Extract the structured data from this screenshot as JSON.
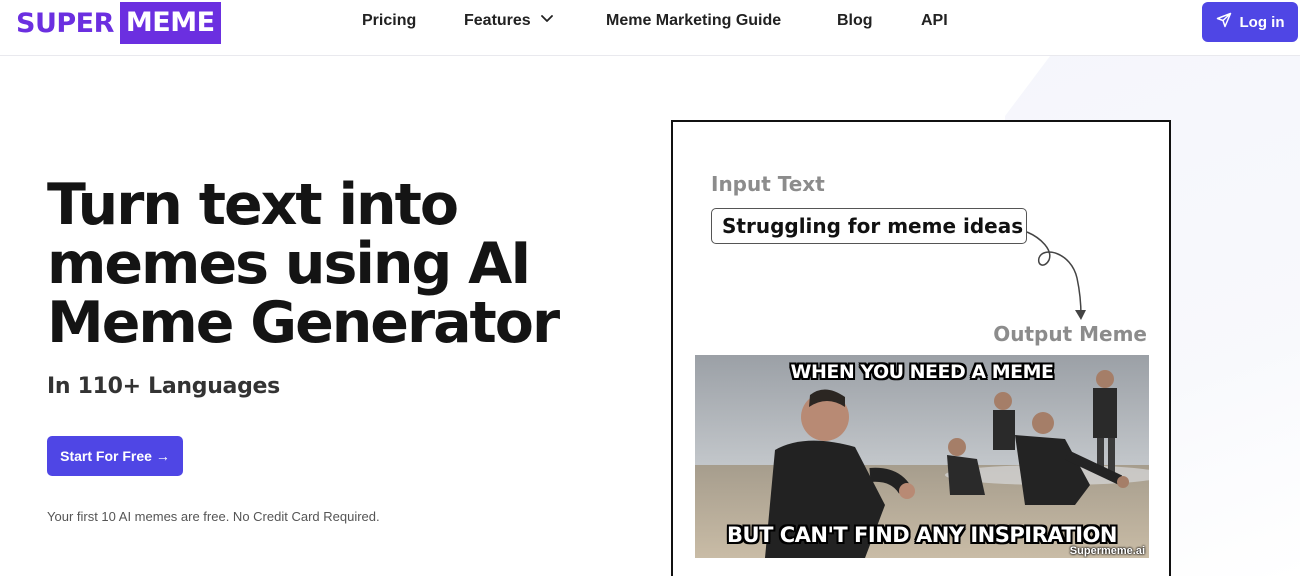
{
  "header": {
    "logo_part1": "SUPER",
    "logo_part2": "MEME",
    "nav": [
      {
        "label": "Pricing"
      },
      {
        "label": "Features",
        "icon": "chevron-down-icon"
      },
      {
        "label": "Meme Marketing Guide"
      },
      {
        "label": "Blog"
      },
      {
        "label": "API"
      }
    ],
    "login_label": "Log in",
    "login_icon": "send-icon"
  },
  "hero": {
    "title_lines": [
      "Turn text into",
      "memes using AI",
      "Meme Generator"
    ],
    "subtitle": "In 110+ Languages",
    "cta_label": "Start For Free →",
    "note": "Your first 10 AI memes are free. No Credit Card Required."
  },
  "demo": {
    "input_label": "Input Text",
    "input_value": "Struggling for meme ideas",
    "output_label": "Output Meme",
    "meme_top": "WHEN YOU NEED A MEME",
    "meme_bottom": "BUT CAN'T FIND ANY INSPIRATION",
    "watermark": "Supermeme.ai"
  },
  "colors": {
    "brand": "#6b2fe0",
    "accent": "#4f46e5",
    "label_gray": "#8c8c8c"
  }
}
